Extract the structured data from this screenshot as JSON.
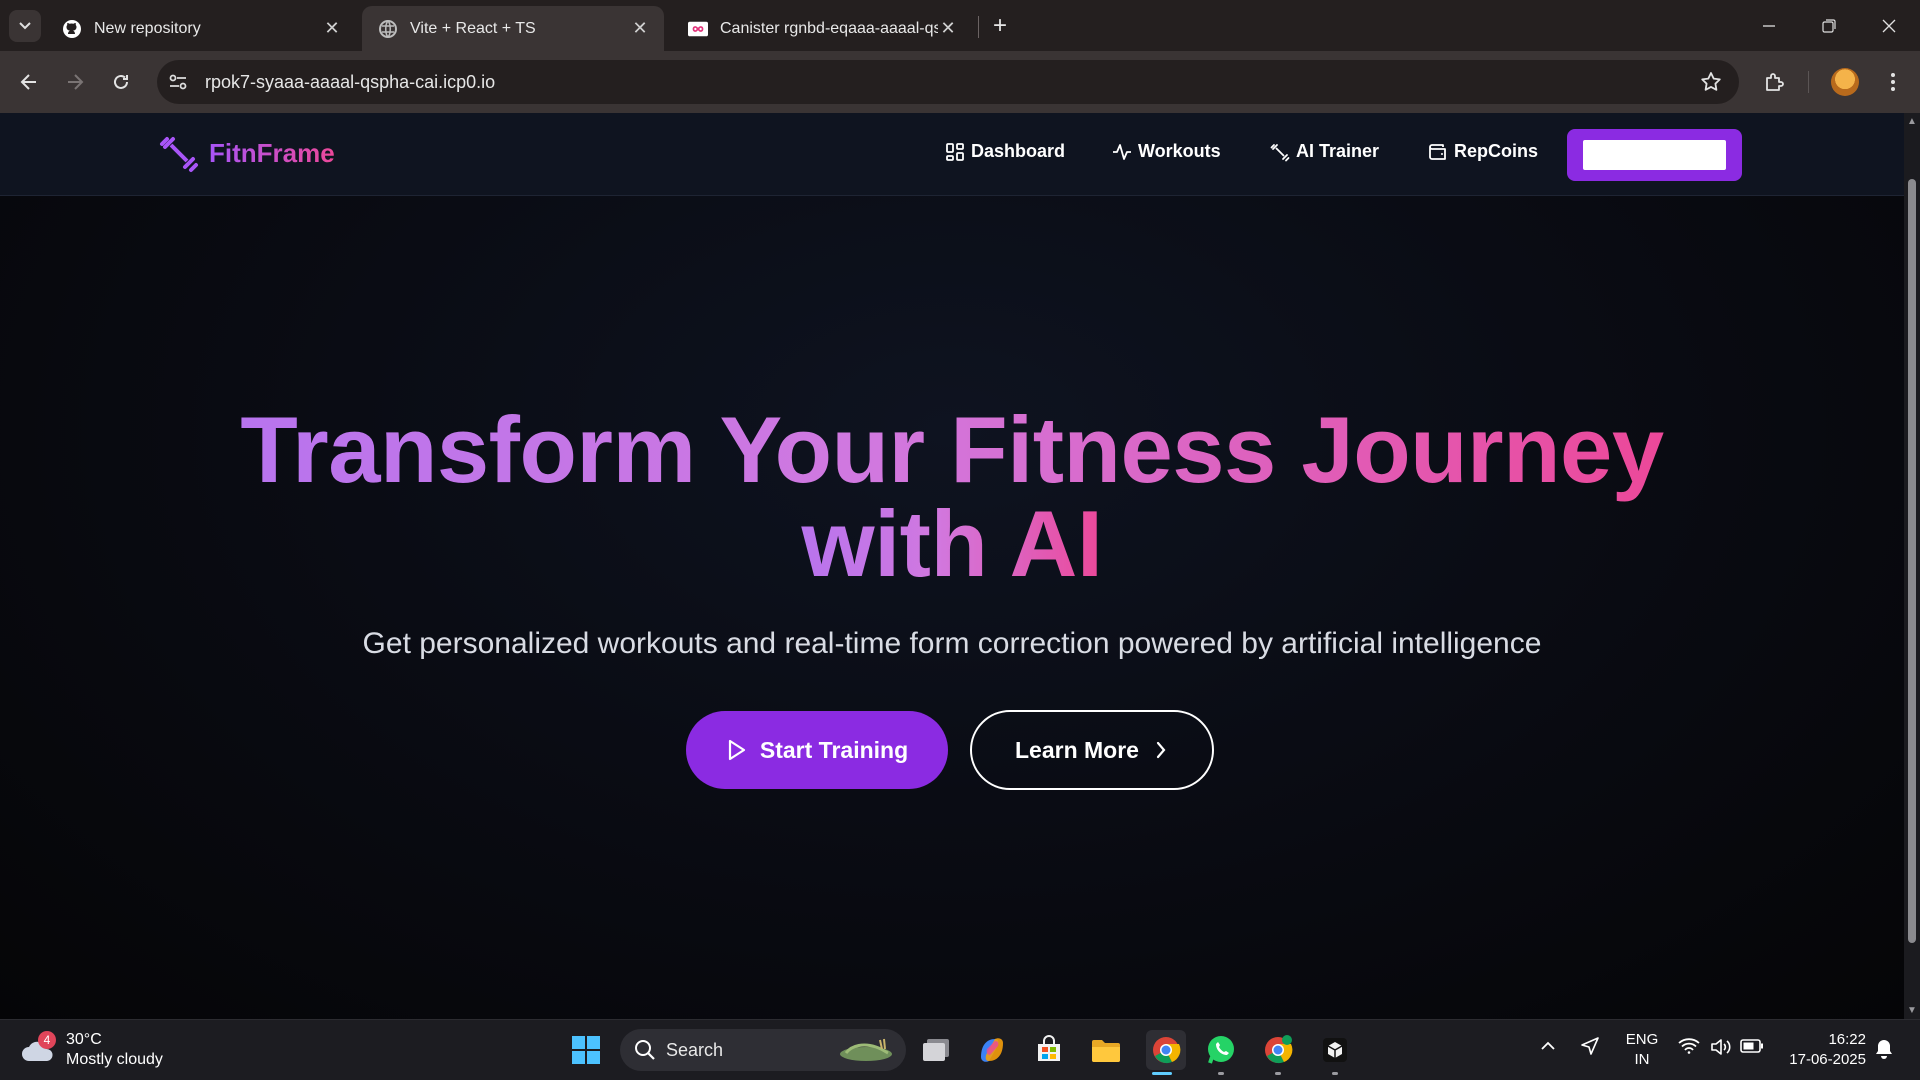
{
  "browser": {
    "tabs": [
      {
        "title": "New repository",
        "active": false
      },
      {
        "title": "Vite + React + TS",
        "active": true
      },
      {
        "title": "Canister rgnbd-eqaaa-aaaal-qs",
        "active": false
      }
    ],
    "url": "rpok7-syaaa-aaaal-qspha-cai.icp0.io"
  },
  "app": {
    "brand": "FitnFrame",
    "nav": [
      {
        "label": "Dashboard",
        "icon": "grid-icon"
      },
      {
        "label": "Workouts",
        "icon": "activity-icon"
      },
      {
        "label": "AI Trainer",
        "icon": "dumbbell-icon"
      },
      {
        "label": "RepCoins",
        "icon": "wallet-icon"
      }
    ],
    "colors": {
      "accent": "#8b2be2",
      "gradient_start": "#a855f7",
      "gradient_end": "#ec4899"
    }
  },
  "hero": {
    "title_line1": "Transform Your Fitness Journey",
    "title_line2": "with AI",
    "subtitle": "Get personalized workouts and real-time form correction powered by artificial intelligence",
    "primary_button": "Start Training",
    "secondary_button": "Learn More"
  },
  "taskbar": {
    "weather_badge": "4",
    "temperature": "30°C",
    "condition": "Mostly cloudy",
    "search_label": "Search",
    "language": "ENG",
    "region": "IN",
    "time": "16:22",
    "date": "17-06-2025"
  }
}
